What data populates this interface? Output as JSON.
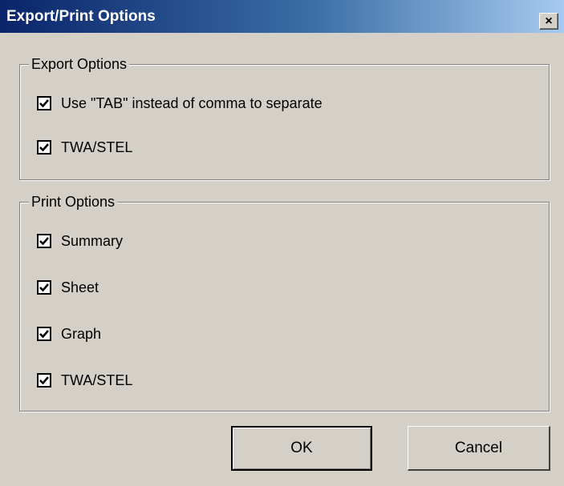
{
  "window": {
    "title": "Export/Print Options",
    "close_glyph": "×"
  },
  "export_options": {
    "legend": "Export Options",
    "items": [
      {
        "label": "Use \"TAB\" instead of comma to separate",
        "checked": true
      },
      {
        "label": "TWA/STEL",
        "checked": true
      }
    ]
  },
  "print_options": {
    "legend": "Print Options",
    "items": [
      {
        "label": "Summary",
        "checked": true
      },
      {
        "label": "Sheet",
        "checked": true
      },
      {
        "label": "Graph",
        "checked": true
      },
      {
        "label": "TWA/STEL",
        "checked": true
      }
    ]
  },
  "buttons": {
    "ok": "OK",
    "cancel": "Cancel"
  },
  "colors": {
    "face": "#d4d0c8",
    "title_start": "#0a246a",
    "title_end": "#a6caf0"
  }
}
